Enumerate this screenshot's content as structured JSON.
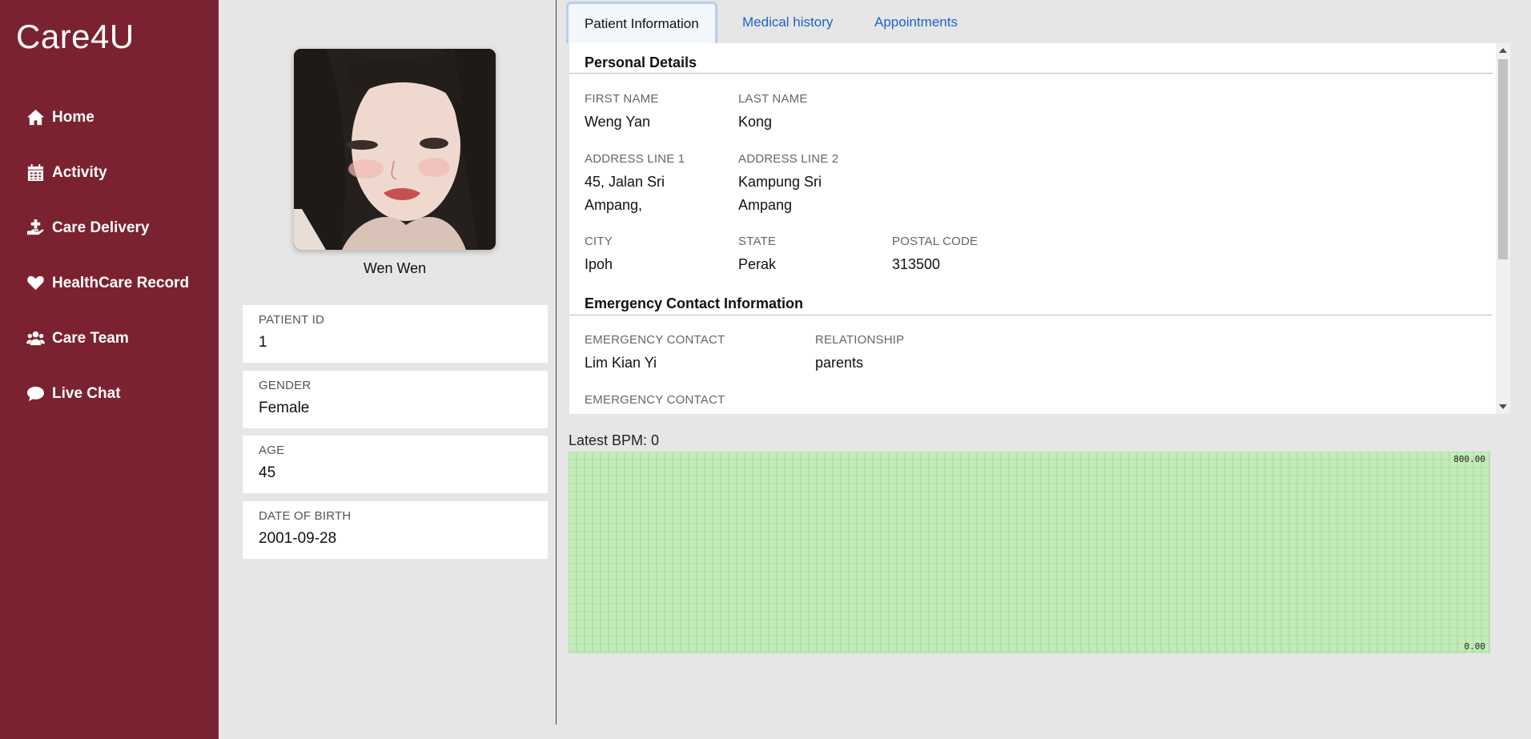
{
  "app": {
    "brand": "Care4U"
  },
  "sidebar": {
    "items": [
      {
        "label": "Home",
        "icon": "home-icon"
      },
      {
        "label": "Activity",
        "icon": "calendar-icon"
      },
      {
        "label": "Care Delivery",
        "icon": "hand-holding-medical-icon"
      },
      {
        "label": "HealthCare Record",
        "icon": "heart-icon"
      },
      {
        "label": "Care Team",
        "icon": "users-icon"
      },
      {
        "label": "Live Chat",
        "icon": "chat-bubble-icon"
      }
    ]
  },
  "profile": {
    "name": "Wen Wen",
    "cards": [
      {
        "label": "Patient ID",
        "value": "1"
      },
      {
        "label": "Gender",
        "value": "Female"
      },
      {
        "label": "Age",
        "value": "45"
      },
      {
        "label": "Date of Birth",
        "value": "2001-09-28"
      }
    ]
  },
  "tabs": [
    {
      "label": "Patient Information",
      "active": true
    },
    {
      "label": "Medical history",
      "active": false
    },
    {
      "label": "Appointments",
      "active": false
    }
  ],
  "personal_details": {
    "title": "Personal Details",
    "first_name_label": "First Name",
    "first_name": "Weng Yan",
    "last_name_label": "Last Name",
    "last_name": "Kong",
    "address1_label": "Address Line 1",
    "address1_l1": "45, Jalan Sri",
    "address1_l2": "Ampang,",
    "address2_label": "Address Line 2",
    "address2_l1": "Kampung Sri",
    "address2_l2": "Ampang",
    "city_label": "City",
    "city": "Ipoh",
    "state_label": "State",
    "state": "Perak",
    "postal_label": "Postal Code",
    "postal": "313500"
  },
  "emergency": {
    "title": "Emergency Contact Information",
    "contact_label": "Emergency Contact",
    "contact": "Lim Kian Yi",
    "relationship_label": "Relationship",
    "relationship": "parents",
    "contact2_label": "Emergency Contact"
  },
  "bpm": {
    "label": "Latest BPM: 0",
    "y_max_label": "800.00",
    "y_min_label": "0.00",
    "colors": {
      "background": "#c4ecba",
      "grid": "#8fc98a"
    }
  },
  "chart_data": {
    "type": "line",
    "title": "",
    "ylim": [
      0,
      800
    ],
    "tick_labels": [
      "800.00",
      "0.00"
    ],
    "series": [],
    "grid": true
  }
}
